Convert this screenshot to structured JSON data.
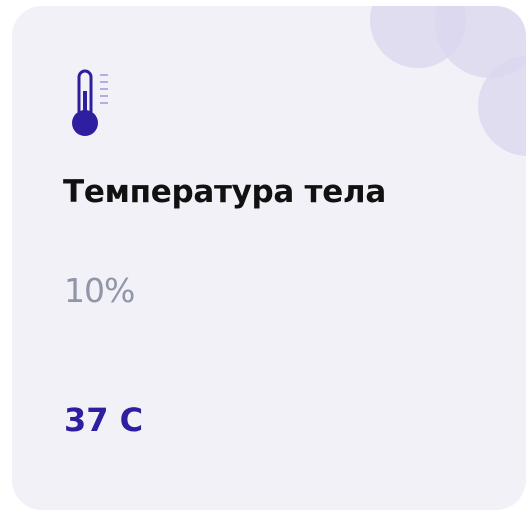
{
  "card": {
    "title": "Температура тела",
    "percent": "10%",
    "value": "37 C",
    "icon": "thermometer-icon"
  },
  "colors": {
    "card_background": "#f2f1f8",
    "accent": "#2d1fa0",
    "decoration": "#d9d6ef",
    "muted_text": "#9096a8",
    "title_text": "#111111"
  }
}
